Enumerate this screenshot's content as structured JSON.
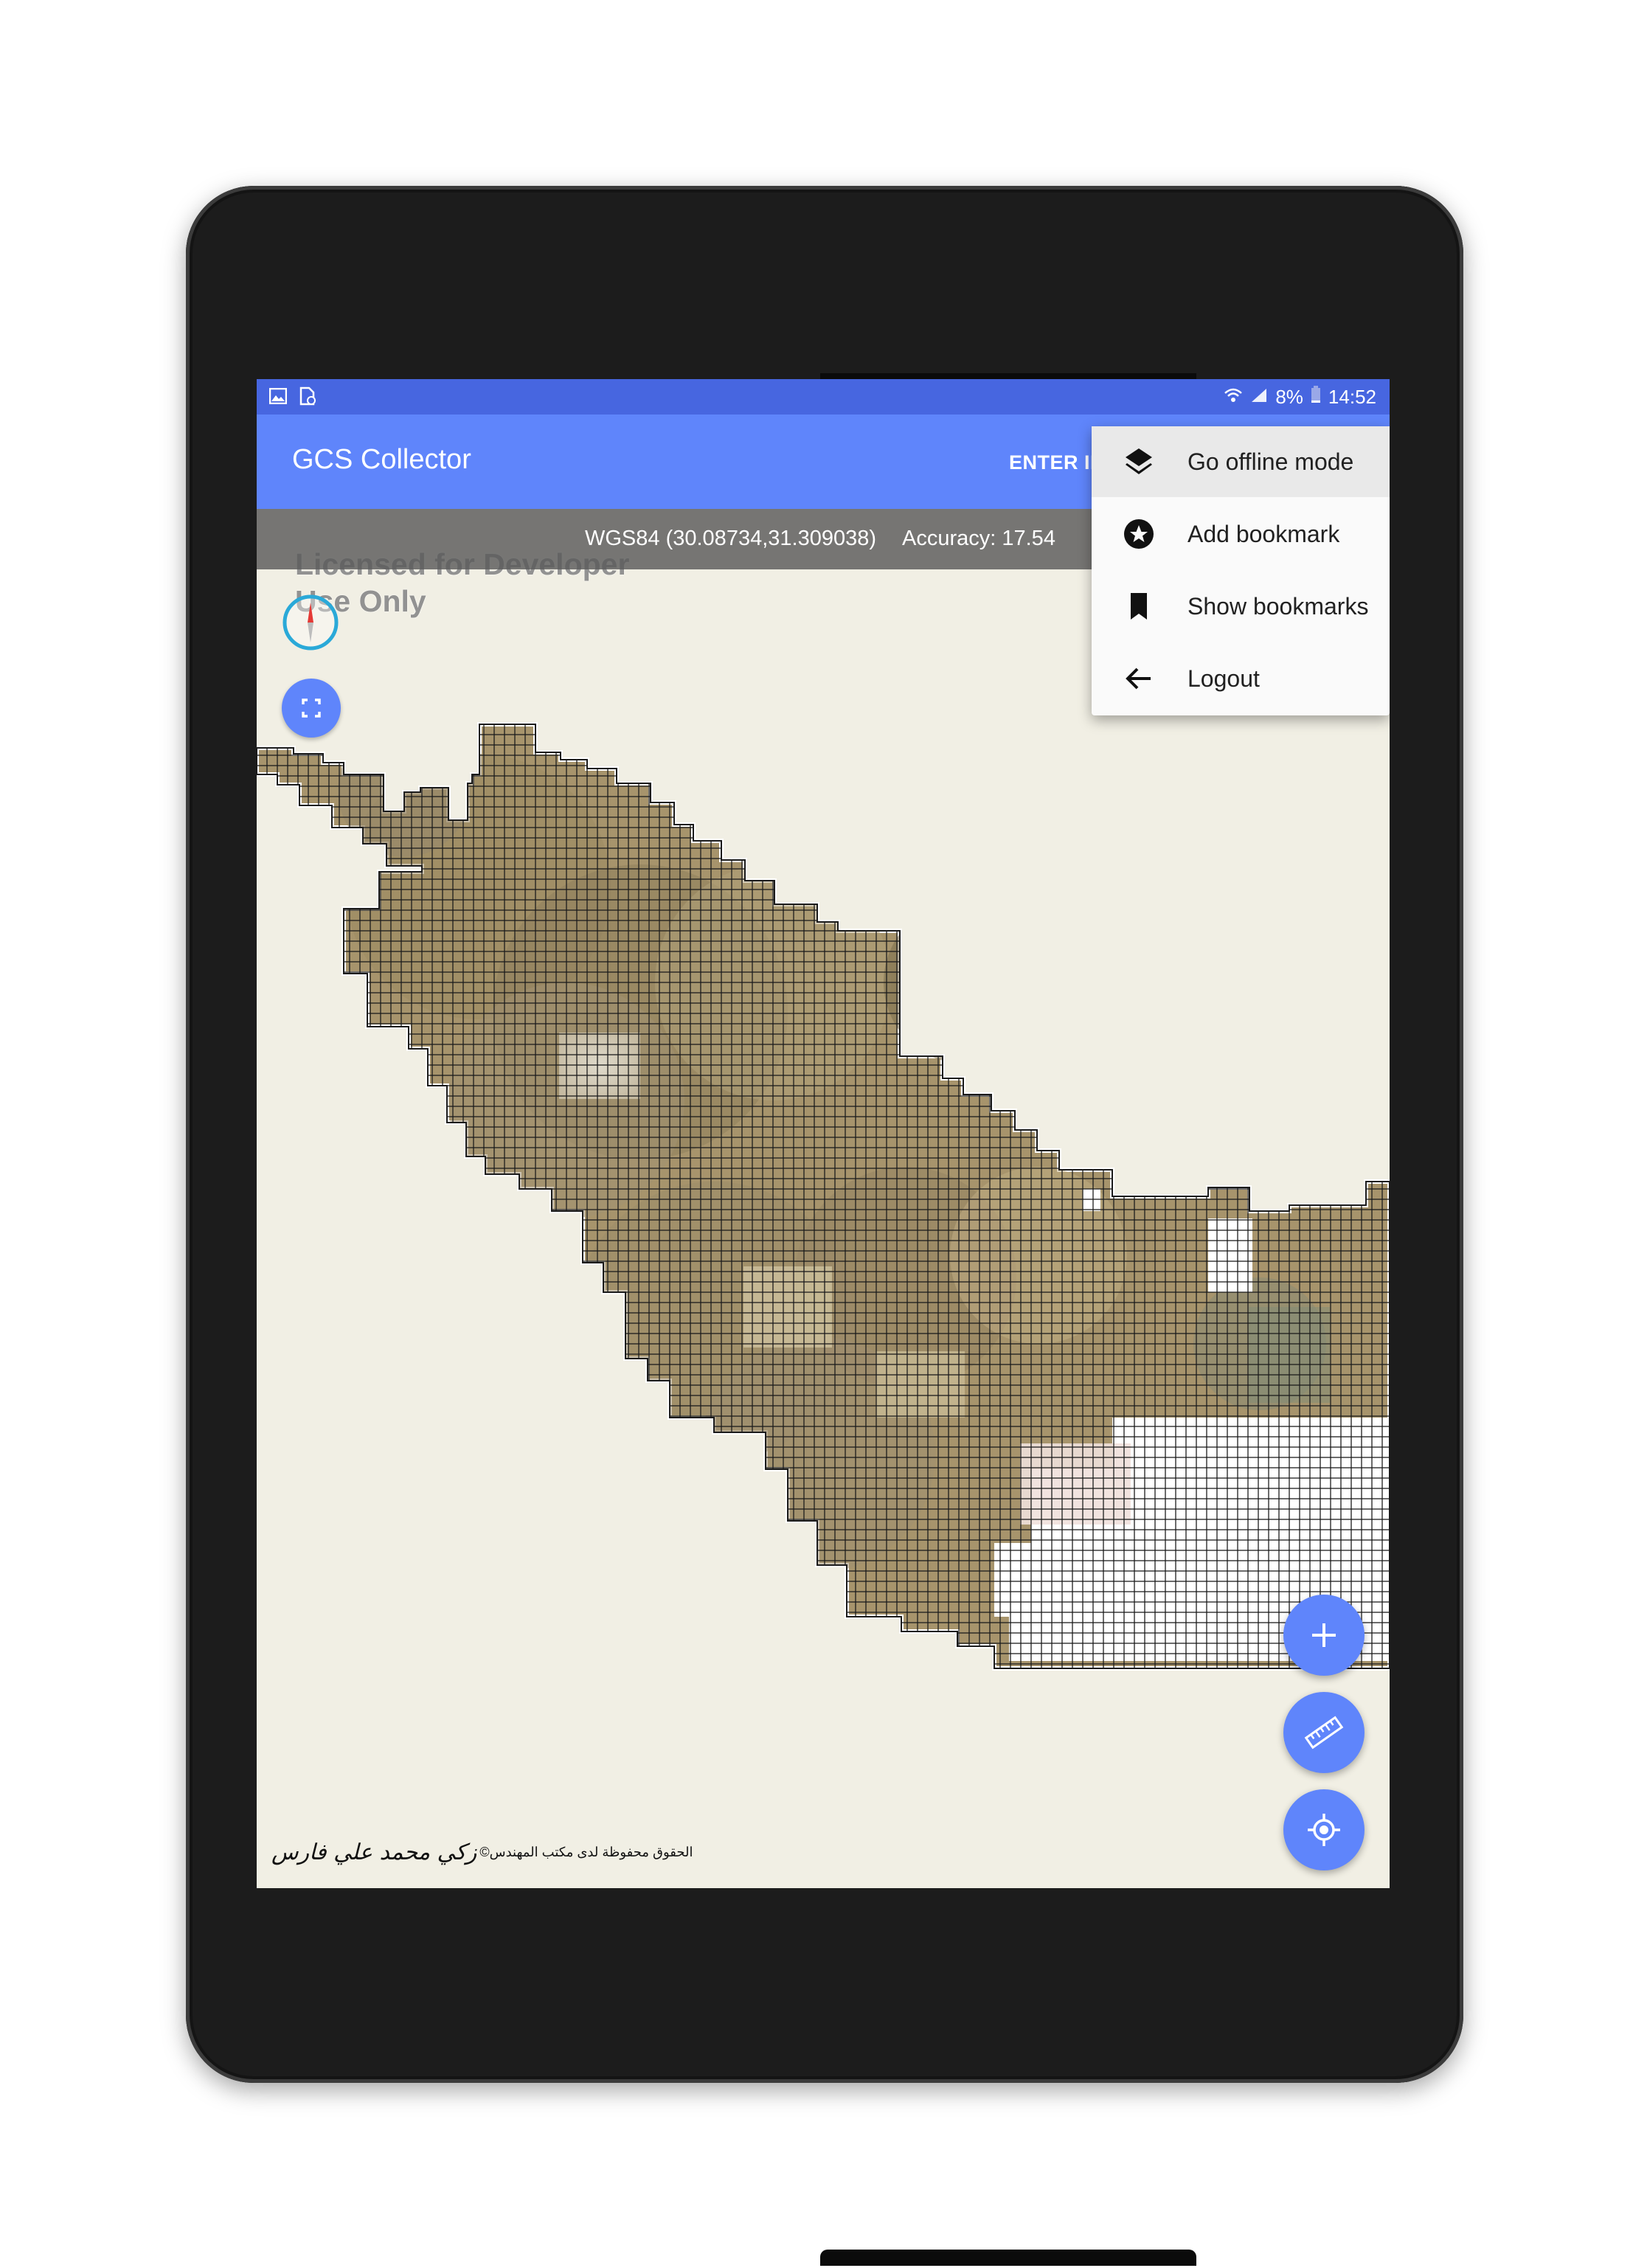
{
  "status_bar": {
    "battery": "8%",
    "time": "14:52",
    "left_icons": [
      "gallery-icon",
      "file-download-icon"
    ],
    "right_icons": [
      "wifi-icon",
      "signal-icon",
      "battery-icon"
    ]
  },
  "app_bar": {
    "title": "GCS Collector",
    "enter_button": "ENTER IN",
    "color": "#5f85fb"
  },
  "coord_bar": {
    "coordinates": "WGS84 (30.08734,31.309038)",
    "accuracy": "Accuracy: 17.54"
  },
  "map": {
    "watermark": "Licensed for Developer\nUse Only",
    "copyright_text": "©الحقوق محفوظة لدى مكتب المهندس",
    "copyright_signature": "زكي محمد علي فارس",
    "controls": [
      "compass-icon",
      "fullscreen-icon"
    ]
  },
  "menu": {
    "items": [
      {
        "label": "Go offline mode",
        "icon": "layers-icon"
      },
      {
        "label": "Add bookmark",
        "icon": "star-circle-icon"
      },
      {
        "label": "Show bookmarks",
        "icon": "bookmark-icon"
      },
      {
        "label": "Logout",
        "icon": "arrow-back-icon"
      }
    ]
  },
  "fabs": [
    "add-icon",
    "ruler-icon",
    "my-location-icon"
  ]
}
